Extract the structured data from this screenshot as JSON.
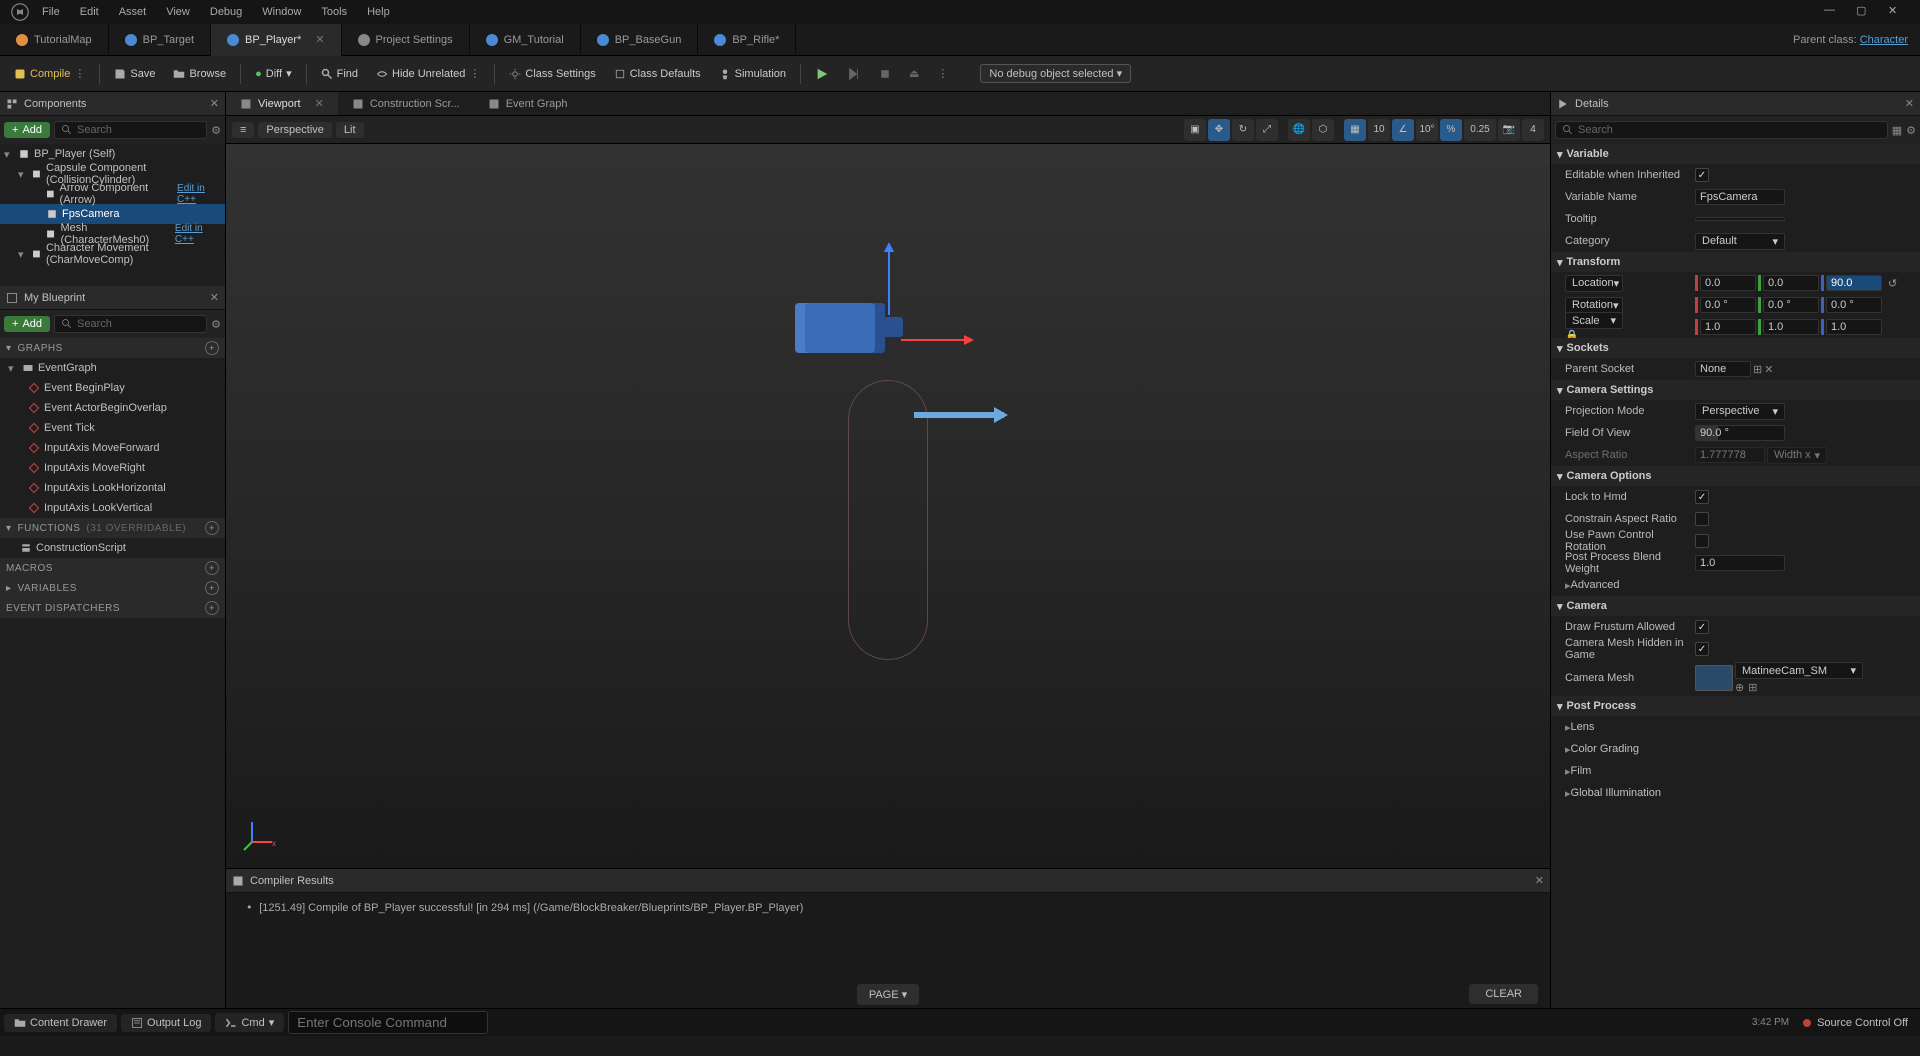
{
  "menubar": [
    "File",
    "Edit",
    "Asset",
    "View",
    "Debug",
    "Window",
    "Tools",
    "Help"
  ],
  "parent_class_label": "Parent class:",
  "parent_class_link": "Character",
  "tabs": [
    {
      "label": "TutorialMap",
      "color": "#e09040"
    },
    {
      "label": "BP_Target",
      "color": "#4a8ad4"
    },
    {
      "label": "BP_Player*",
      "color": "#4a8ad4",
      "active": true
    },
    {
      "label": "Project Settings",
      "color": "#888"
    },
    {
      "label": "GM_Tutorial",
      "color": "#4a8ad4"
    },
    {
      "label": "BP_BaseGun",
      "color": "#4a8ad4"
    },
    {
      "label": "BP_Rifle*",
      "color": "#4a8ad4"
    }
  ],
  "toolbar": {
    "compile": "Compile",
    "save": "Save",
    "browse": "Browse",
    "diff": "Diff",
    "find": "Find",
    "hide": "Hide Unrelated",
    "class_settings": "Class Settings",
    "class_defaults": "Class Defaults",
    "simulation": "Simulation",
    "debug_filter": "No debug object selected"
  },
  "components": {
    "title": "Components",
    "add": "Add",
    "search_ph": "Search",
    "items": [
      {
        "label": "BP_Player (Self)",
        "indent": 0,
        "icon": "cube"
      },
      {
        "label": "Capsule Component (CollisionCylinder)",
        "indent": 1,
        "icon": "capsule"
      },
      {
        "label": "Arrow Component (Arrow)",
        "indent": 2,
        "icon": "arrow",
        "edit": "Edit in C++"
      },
      {
        "label": "FpsCamera",
        "indent": 2,
        "icon": "camera",
        "selected": true
      },
      {
        "label": "Mesh (CharacterMesh0)",
        "indent": 2,
        "icon": "mesh",
        "edit": "Edit in C++"
      },
      {
        "label": "Character Movement (CharMoveComp)",
        "indent": 1,
        "icon": "move"
      }
    ]
  },
  "myblueprint": {
    "title": "My Blueprint",
    "add": "Add",
    "search_ph": "Search",
    "graphs_label": "GRAPHS",
    "eventgraph": "EventGraph",
    "events": [
      "Event BeginPlay",
      "Event ActorBeginOverlap",
      "Event Tick",
      "InputAxis MoveForward",
      "InputAxis MoveRight",
      "InputAxis LookHorizontal",
      "InputAxis LookVertical"
    ],
    "functions_label": "FUNCTIONS",
    "functions_count": "(31 OVERRIDABLE)",
    "construction": "ConstructionScript",
    "macros_label": "MACROS",
    "variables_label": "VARIABLES",
    "dispatchers_label": "EVENT DISPATCHERS"
  },
  "center_tabs": [
    {
      "label": "Viewport",
      "active": true
    },
    {
      "label": "Construction Scr..."
    },
    {
      "label": "Event Graph"
    }
  ],
  "viewport": {
    "menu": "≡",
    "perspective": "Perspective",
    "lit": "Lit",
    "grid_snap": "10",
    "angle_snap": "10°",
    "scale_snap": "0.25",
    "cam_speed": "4"
  },
  "compiler": {
    "title": "Compiler Results",
    "msg": "[1251.49] Compile of BP_Player successful! [in 294 ms] (/Game/BlockBreaker/Blueprints/BP_Player.BP_Player)",
    "page": "PAGE",
    "clear": "CLEAR"
  },
  "details": {
    "title": "Details",
    "search_ph": "Search",
    "variable_hdr": "Variable",
    "editable_label": "Editable when Inherited",
    "editable_val": true,
    "varname_label": "Variable Name",
    "varname_val": "FpsCamera",
    "tooltip_label": "Tooltip",
    "tooltip_val": "",
    "category_label": "Category",
    "category_val": "Default",
    "transform_hdr": "Transform",
    "location_label": "Location",
    "location": [
      "0.0",
      "0.0",
      "90.0"
    ],
    "rotation_label": "Rotation",
    "rotation": [
      "0.0 °",
      "0.0 °",
      "0.0 °"
    ],
    "scale_label": "Scale",
    "scale": [
      "1.0",
      "1.0",
      "1.0"
    ],
    "sockets_hdr": "Sockets",
    "parent_socket_label": "Parent Socket",
    "parent_socket_val": "None",
    "camsettings_hdr": "Camera Settings",
    "projmode_label": "Projection Mode",
    "projmode_val": "Perspective",
    "fov_label": "Field Of View",
    "fov_val": "90.0 °",
    "aspect_label": "Aspect Ratio",
    "aspect_val": "1.777778",
    "aspect_dim": "Width x",
    "camoptions_hdr": "Camera Options",
    "lockhmd_label": "Lock to Hmd",
    "lockhmd_val": true,
    "constrain_label": "Constrain Aspect Ratio",
    "constrain_val": false,
    "pawnctrl_label": "Use Pawn Control Rotation",
    "pawnctrl_val": false,
    "ppblend_label": "Post Process Blend Weight",
    "ppblend_val": "1.0",
    "advanced_label": "Advanced",
    "camera_hdr": "Camera",
    "frustum_label": "Draw Frustum Allowed",
    "frustum_val": true,
    "hidden_label": "Camera Mesh Hidden in Game",
    "hidden_val": true,
    "cammesh_label": "Camera Mesh",
    "cammesh_val": "MatineeCam_SM",
    "postprocess_hdr": "Post Process",
    "lens_label": "Lens",
    "colorgrading_label": "Color Grading",
    "film_label": "Film",
    "globalillum_label": "Global Illumination"
  },
  "bottombar": {
    "content_drawer": "Content Drawer",
    "output_log": "Output Log",
    "cmd": "Cmd",
    "cmd_ph": "Enter Console Command",
    "source_control": "Source Control Off",
    "time": "3:42 PM"
  }
}
